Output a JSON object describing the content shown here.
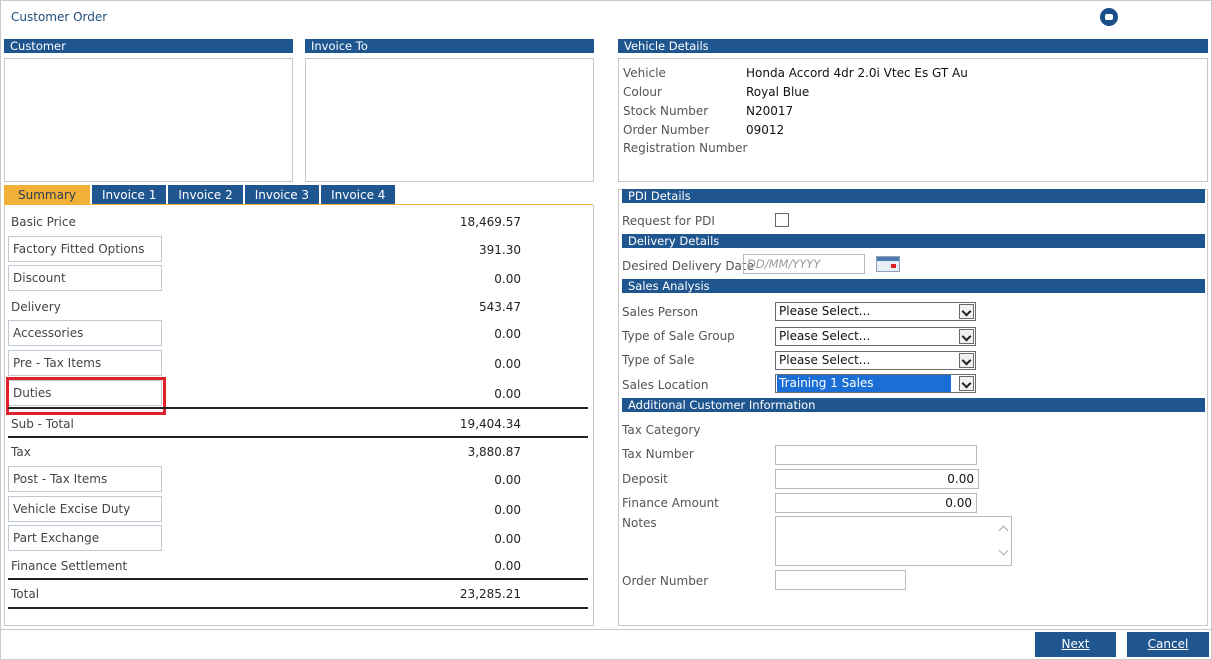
{
  "window": {
    "title": "Customer Order",
    "help_icon": "chat-help-icon"
  },
  "sections": {
    "customer": "Customer",
    "invoice_to": "Invoice To",
    "vehicle_details": "Vehicle Details",
    "pdi_details": "PDI Details",
    "delivery_details": "Delivery Details",
    "sales_analysis": "Sales Analysis",
    "additional_info": "Additional Customer Information"
  },
  "tabs": [
    {
      "label": "Summary",
      "active": true
    },
    {
      "label": "Invoice 1",
      "active": false
    },
    {
      "label": "Invoice 2",
      "active": false
    },
    {
      "label": "Invoice 3",
      "active": false
    },
    {
      "label": "Invoice 4",
      "active": false
    }
  ],
  "summary": {
    "basic_price": {
      "label": "Basic Price",
      "value": "18,469.57"
    },
    "factory_options": {
      "label": "Factory Fitted Options",
      "value": "391.30"
    },
    "discount": {
      "label": "Discount",
      "value": "0.00"
    },
    "delivery": {
      "label": "Delivery",
      "value": "543.47"
    },
    "accessories": {
      "label": "Accessories",
      "value": "0.00"
    },
    "pre_tax": {
      "label": "Pre - Tax Items",
      "value": "0.00"
    },
    "duties": {
      "label": "Duties",
      "value": "0.00"
    },
    "sub_total": {
      "label": "Sub - Total",
      "value": "19,404.34"
    },
    "tax": {
      "label": "Tax",
      "value": "3,880.87"
    },
    "post_tax": {
      "label": "Post - Tax Items",
      "value": "0.00"
    },
    "excise": {
      "label": "Vehicle Excise Duty",
      "value": "0.00"
    },
    "part_exchange": {
      "label": "Part Exchange",
      "value": "0.00"
    },
    "finance_settlement": {
      "label": "Finance Settlement",
      "value": "0.00"
    },
    "total": {
      "label": "Total",
      "value": "23,285.21"
    }
  },
  "vehicle": {
    "vehicle_label": "Vehicle",
    "vehicle_value": "Honda Accord 4dr 2.0i Vtec Es GT Au",
    "colour_label": "Colour",
    "colour_value": "Royal Blue",
    "stock_label": "Stock Number",
    "stock_value": "N20017",
    "order_label": "Order Number",
    "order_value": "09012",
    "reg_label": "Registration Number",
    "reg_value": ""
  },
  "pdi": {
    "request_label": "Request for PDI",
    "checked": false
  },
  "delivery": {
    "date_label": "Desired Delivery Date",
    "date_placeholder": "DD/MM/YYYY",
    "calendar_icon": "calendar-icon"
  },
  "sales": {
    "person_label": "Sales Person",
    "person_value": "Please Select...",
    "group_label": "Type of Sale Group",
    "group_value": "Please Select...",
    "type_label": "Type of Sale",
    "type_value": "Please Select...",
    "location_label": "Sales Location",
    "location_value": "Training 1 Sales"
  },
  "additional": {
    "tax_category_label": "Tax Category",
    "tax_number_label": "Tax Number",
    "tax_number_value": "",
    "deposit_label": "Deposit",
    "deposit_value": "0.00",
    "finance_label": "Finance Amount",
    "finance_value": "0.00",
    "notes_label": "Notes",
    "order_number_label": "Order Number",
    "order_number_value": ""
  },
  "footer": {
    "next_label": "Next",
    "cancel_label": "Cancel"
  },
  "colors": {
    "header_bar": "#1f5690",
    "active_tab": "#f2b136",
    "highlight": "#e0202a",
    "selection": "#1a6ed6"
  }
}
